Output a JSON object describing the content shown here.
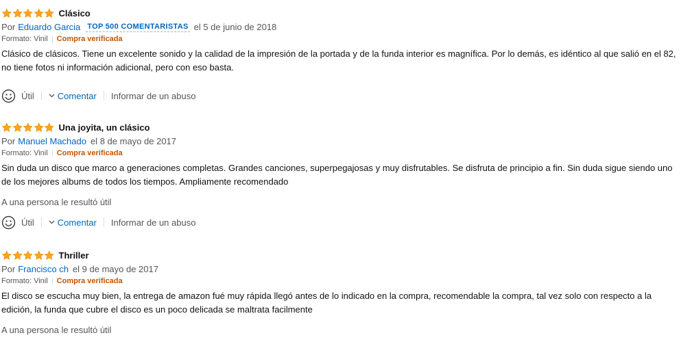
{
  "reviews": [
    {
      "rating": 5,
      "title": "Clásico",
      "by": "Por",
      "author": "Eduardo Garcia",
      "badge": "TOP 500 COMENTARISTAS",
      "date": "el 5 de junio de 2018",
      "format": "Formato: Vinil",
      "verified": "Compra verificada",
      "body": "Clásico de clásicos. Tiene un excelente sonido y la calidad de la impresión de la portada y de la funda interior es magnífica. Por lo demás, es idéntico al que salió en el 82, no tiene fotos ni información adicional, pero con eso basta.",
      "helpful": ""
    },
    {
      "rating": 5,
      "title": "Una joyita, un clásico",
      "by": "Por",
      "author": "Manuel Machado",
      "date": "el 8 de mayo de 2017",
      "format": "Formato: Vinil",
      "verified": "Compra verificada",
      "body": "Sin duda un disco que marco a generaciones completas. Grandes canciones, superpegajosas y muy disfrutables. Se disfruta de principio a fin. Sin duda sigue siendo uno de los mejores albums de todos los tiempos. Ampliamente recomendado",
      "helpful": "A una persona le resultó útil"
    },
    {
      "rating": 5,
      "title": "Thriller",
      "by": "Por",
      "author": "Francisco ch",
      "date": "el 9 de mayo de 2017",
      "format": "Formato: Vinil",
      "verified": "Compra verificada",
      "body": "El disco se escucha muy bien, la entrega de amazon fué muy rápida llegó antes de lo indicado en la compra, recomendable la compra, tal vez solo con respecto a la edición, la funda que cubre el disco es un poco delicada se maltrata facilmente",
      "helpful": "A una persona le resultó útil"
    }
  ],
  "actions": {
    "useful": "Útil",
    "comment": "Comentar",
    "report": "Informar de un abuso"
  },
  "icons": {
    "star": "star-icon",
    "smile": "smile-icon",
    "caret": "chevron-down-icon"
  },
  "colors": {
    "star_fill": "#ffa41c",
    "link": "#0066c0",
    "verified": "#c45500"
  }
}
